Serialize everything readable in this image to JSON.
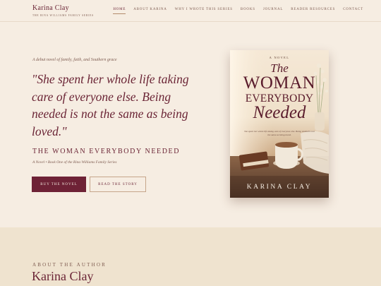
{
  "header": {
    "brand_name": "Karina Clay",
    "brand_sub": "The Rina Williams Family Series",
    "nav": [
      "Home",
      "About Karina",
      "Why I Wrote This Series",
      "Books",
      "Journal",
      "Reader Resources",
      "Contact"
    ],
    "active_nav": "Home"
  },
  "hero": {
    "eyebrow": "A debut novel of family, faith, and Southern grace",
    "quote": "\"She spent her whole life taking care of everyone else. Being needed is not the same as being loved.\"",
    "book_title": "The Woman Everybody Needed",
    "book_subtitle": "A Novel • Book One of the Rina Williams Family Series",
    "primary_button": "Buy the Novel",
    "secondary_button": "Read the Story"
  },
  "cover": {
    "kicker": "A Novel",
    "title_line1": "The",
    "title_line2": "Woman",
    "title_line3": "Everybody",
    "title_line4": "Needed",
    "blurb": "She spent her whole life taking care of everyone else. Being needed is not the same as being loved.",
    "author": "Karina Clay"
  },
  "about": {
    "label": "About the Author",
    "name": "Karina Clay"
  },
  "colors": {
    "background": "#f6ede2",
    "accent_burgundy": "#6e2236",
    "about_band": "#efe3cf"
  }
}
